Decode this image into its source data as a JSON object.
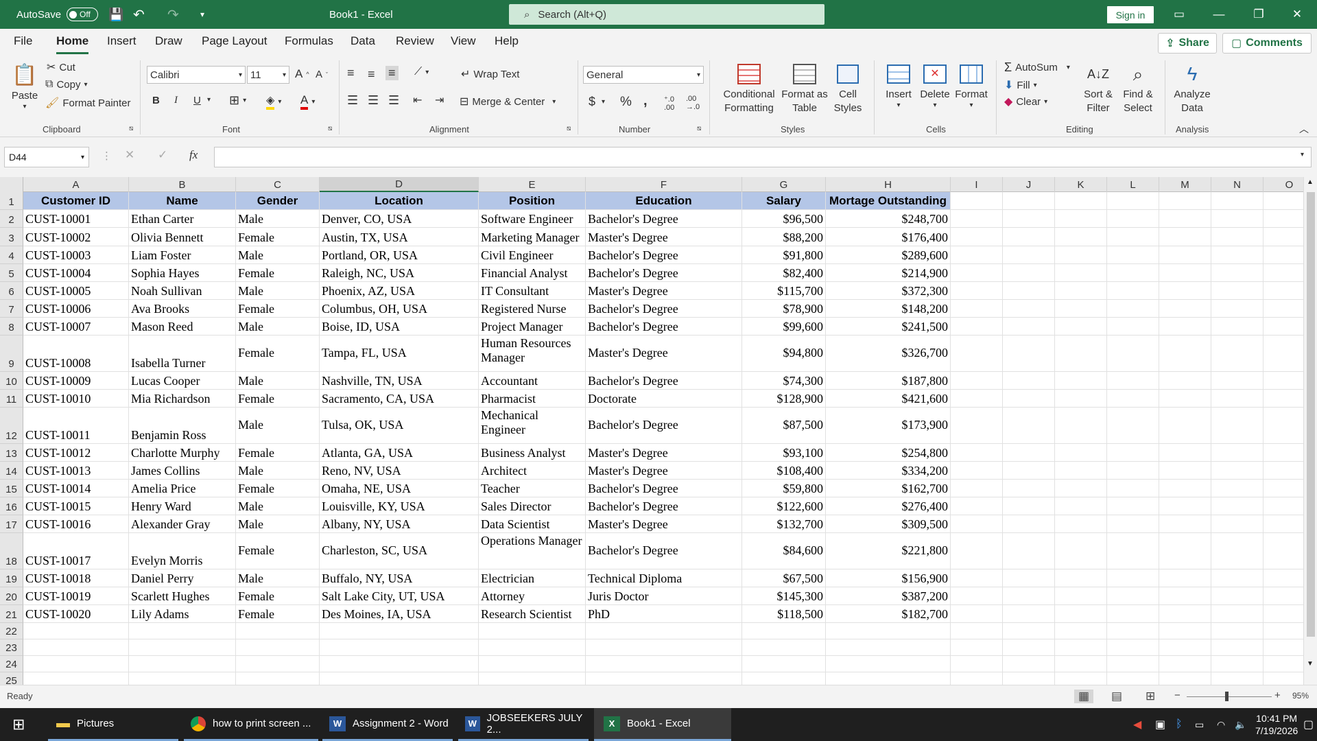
{
  "titlebar": {
    "autosave_label": "AutoSave",
    "autosave_state": "Off",
    "doc_title": "Book1 - Excel",
    "search_placeholder": "Search (Alt+Q)",
    "signin_label": "Sign in"
  },
  "menu": {
    "tabs": [
      "File",
      "Home",
      "Insert",
      "Draw",
      "Page Layout",
      "Formulas",
      "Data",
      "Review",
      "View",
      "Help"
    ],
    "active": "Home",
    "share_label": "Share",
    "comments_label": "Comments"
  },
  "ribbon": {
    "clipboard": {
      "paste": "Paste",
      "cut": "Cut",
      "copy": "Copy",
      "format_painter": "Format Painter",
      "label": "Clipboard"
    },
    "font": {
      "name": "Calibri",
      "size": "11",
      "bold": "B",
      "italic": "I",
      "underline": "U",
      "label": "Font"
    },
    "alignment": {
      "wrap": "Wrap Text",
      "merge": "Merge & Center",
      "label": "Alignment"
    },
    "number": {
      "format": "General",
      "label": "Number"
    },
    "styles": {
      "conditional": [
        "Conditional",
        "Formatting"
      ],
      "format_table": [
        "Format as",
        "Table"
      ],
      "cell_styles": [
        "Cell",
        "Styles"
      ],
      "label": "Styles"
    },
    "cells": {
      "insert": "Insert",
      "delete": "Delete",
      "format": "Format",
      "label": "Cells"
    },
    "editing": {
      "autosum": "AutoSum",
      "fill": "Fill",
      "clear": "Clear",
      "sort": [
        "Sort &",
        "Filter"
      ],
      "find": [
        "Find &",
        "Select"
      ],
      "label": "Editing"
    },
    "analysis": {
      "analyze": [
        "Analyze",
        "Data"
      ],
      "label": "Analysis"
    }
  },
  "formula_bar": {
    "name_box": "D44",
    "fx": "fx",
    "value": ""
  },
  "sheet": {
    "columns": [
      "A",
      "B",
      "C",
      "D",
      "E",
      "F",
      "G",
      "H",
      "I",
      "J",
      "K",
      "L",
      "M",
      "N",
      "O"
    ],
    "selected_column": "D",
    "headers": [
      "Customer ID",
      "Name",
      "Gender",
      "Location",
      "Position",
      "Education",
      "Salary",
      "Mortage Outstanding"
    ],
    "rows": [
      [
        "CUST-10001",
        "Ethan Carter",
        "Male",
        "Denver, CO, USA",
        "Software Engineer",
        "Bachelor's Degree",
        "$96,500",
        "$248,700"
      ],
      [
        "CUST-10002",
        "Olivia Bennett",
        "Female",
        "Austin, TX, USA",
        "Marketing Manager",
        "Master's Degree",
        "$88,200",
        "$176,400"
      ],
      [
        "CUST-10003",
        "Liam Foster",
        "Male",
        "Portland, OR, USA",
        "Civil Engineer",
        "Bachelor's Degree",
        "$91,800",
        "$289,600"
      ],
      [
        "CUST-10004",
        "Sophia Hayes",
        "Female",
        "Raleigh, NC, USA",
        "Financial Analyst",
        "Bachelor's Degree",
        "$82,400",
        "$214,900"
      ],
      [
        "CUST-10005",
        "Noah Sullivan",
        "Male",
        "Phoenix, AZ, USA",
        "IT Consultant",
        "Master's Degree",
        "$115,700",
        "$372,300"
      ],
      [
        "CUST-10006",
        "Ava Brooks",
        "Female",
        "Columbus, OH, USA",
        "Registered Nurse",
        "Bachelor's Degree",
        "$78,900",
        "$148,200"
      ],
      [
        "CUST-10007",
        "Mason Reed",
        "Male",
        "Boise, ID, USA",
        "Project Manager",
        "Bachelor's Degree",
        "$99,600",
        "$241,500"
      ],
      [
        "CUST-10008",
        "Isabella Turner",
        "Female",
        "Tampa, FL, USA",
        "Human Resources Manager",
        "Master's Degree",
        "$94,800",
        "$326,700"
      ],
      [
        "CUST-10009",
        "Lucas Cooper",
        "Male",
        "Nashville, TN, USA",
        "Accountant",
        "Bachelor's Degree",
        "$74,300",
        "$187,800"
      ],
      [
        "CUST-10010",
        "Mia Richardson",
        "Female",
        "Sacramento, CA, USA",
        "Pharmacist",
        "Doctorate",
        "$128,900",
        "$421,600"
      ],
      [
        "CUST-10011",
        "Benjamin Ross",
        "Male",
        "Tulsa, OK, USA",
        "Mechanical Engineer",
        "Bachelor's Degree",
        "$87,500",
        "$173,900"
      ],
      [
        "CUST-10012",
        "Charlotte Murphy",
        "Female",
        "Atlanta, GA, USA",
        "Business Analyst",
        "Master's Degree",
        "$93,100",
        "$254,800"
      ],
      [
        "CUST-10013",
        "James Collins",
        "Male",
        "Reno, NV, USA",
        "Architect",
        "Master's Degree",
        "$108,400",
        "$334,200"
      ],
      [
        "CUST-10014",
        "Amelia Price",
        "Female",
        "Omaha, NE, USA",
        "Teacher",
        "Bachelor's Degree",
        "$59,800",
        "$162,700"
      ],
      [
        "CUST-10015",
        "Henry Ward",
        "Male",
        "Louisville, KY, USA",
        "Sales Director",
        "Bachelor's Degree",
        "$122,600",
        "$276,400"
      ],
      [
        "CUST-10016",
        "Alexander Gray",
        "Male",
        "Albany, NY, USA",
        "Data Scientist",
        "Master's Degree",
        "$132,700",
        "$309,500"
      ],
      [
        "CUST-10017",
        "Evelyn Morris",
        "Female",
        "Charleston, SC, USA",
        "Operations Manager",
        "Bachelor's Degree",
        "$84,600",
        "$221,800"
      ],
      [
        "CUST-10018",
        "Daniel Perry",
        "Male",
        "Buffalo, NY, USA",
        "Electrician",
        "Technical Diploma",
        "$67,500",
        "$156,900"
      ],
      [
        "CUST-10019",
        "Scarlett Hughes",
        "Female",
        "Salt Lake City, UT, USA",
        "Attorney",
        "Juris Doctor",
        "$145,300",
        "$387,200"
      ],
      [
        "CUST-10020",
        "Lily Adams",
        "Female",
        "Des Moines, IA, USA",
        "Research Scientist",
        "PhD",
        "$118,500",
        "$182,700"
      ]
    ],
    "row_numbers": [
      "1",
      "2",
      "3",
      "4",
      "5",
      "6",
      "7",
      "8",
      "9",
      "10",
      "11",
      "12",
      "13",
      "14",
      "15",
      "16",
      "17",
      "18",
      "19",
      "20",
      "21",
      "22",
      "23",
      "24",
      "25"
    ]
  },
  "status": {
    "ready": "Ready",
    "zoom": "95%"
  },
  "taskbar": {
    "items": [
      "Pictures",
      "how to print screen ...",
      "Assignment 2 - Word",
      "JOBSEEKERS JULY 2...",
      "Book1 - Excel"
    ],
    "time": "10:41 PM",
    "date": "7/19/2026"
  },
  "colors": {
    "accent": "#217346",
    "header_fill": "#b4c6e7"
  }
}
